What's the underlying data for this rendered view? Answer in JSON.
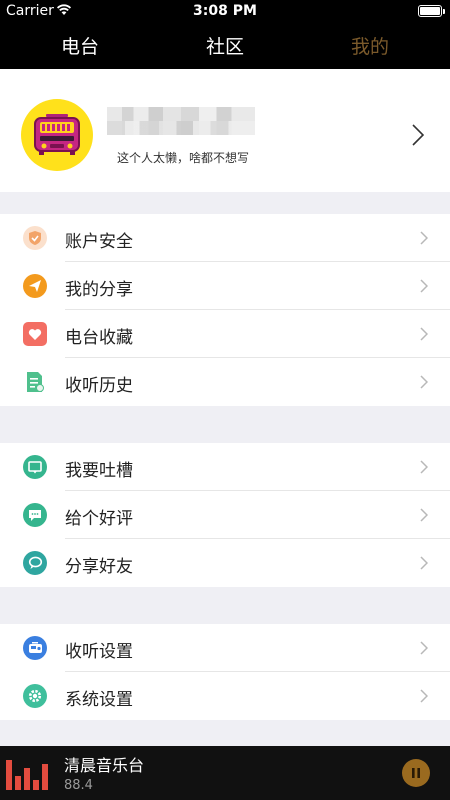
{
  "status_bar": {
    "carrier": "Carrier",
    "time": "3:08 PM"
  },
  "tabs": [
    {
      "label": "电台"
    },
    {
      "label": "社区"
    },
    {
      "label": "我的"
    }
  ],
  "profile": {
    "signature": "这个人太懒，啥都不想写"
  },
  "menu": {
    "group1": [
      {
        "label": "账户安全",
        "icon": "shield-icon",
        "color": "#f6c29b"
      },
      {
        "label": "我的分享",
        "icon": "paper-plane-icon",
        "color": "#f39a1d"
      },
      {
        "label": "电台收藏",
        "icon": "heart-icon",
        "color": "#f36e63"
      },
      {
        "label": "收听历史",
        "icon": "document-icon",
        "color": "#4fc08d"
      }
    ],
    "group2": [
      {
        "label": "我要吐槽",
        "icon": "feedback-icon",
        "color": "#35b58e"
      },
      {
        "label": "给个好评",
        "icon": "chat-bubble-icon",
        "color": "#35b58e"
      },
      {
        "label": "分享好友",
        "icon": "speech-bubble-icon",
        "color": "#2fa6a0"
      }
    ],
    "group3": [
      {
        "label": "收听设置",
        "icon": "radio-settings-icon",
        "color": "#3a7fe0"
      },
      {
        "label": "系统设置",
        "icon": "gear-icon",
        "color": "#3fbf9c"
      }
    ]
  },
  "player": {
    "station": "清晨音乐台",
    "frequency": "88.4",
    "accent": "#e34c3f"
  }
}
